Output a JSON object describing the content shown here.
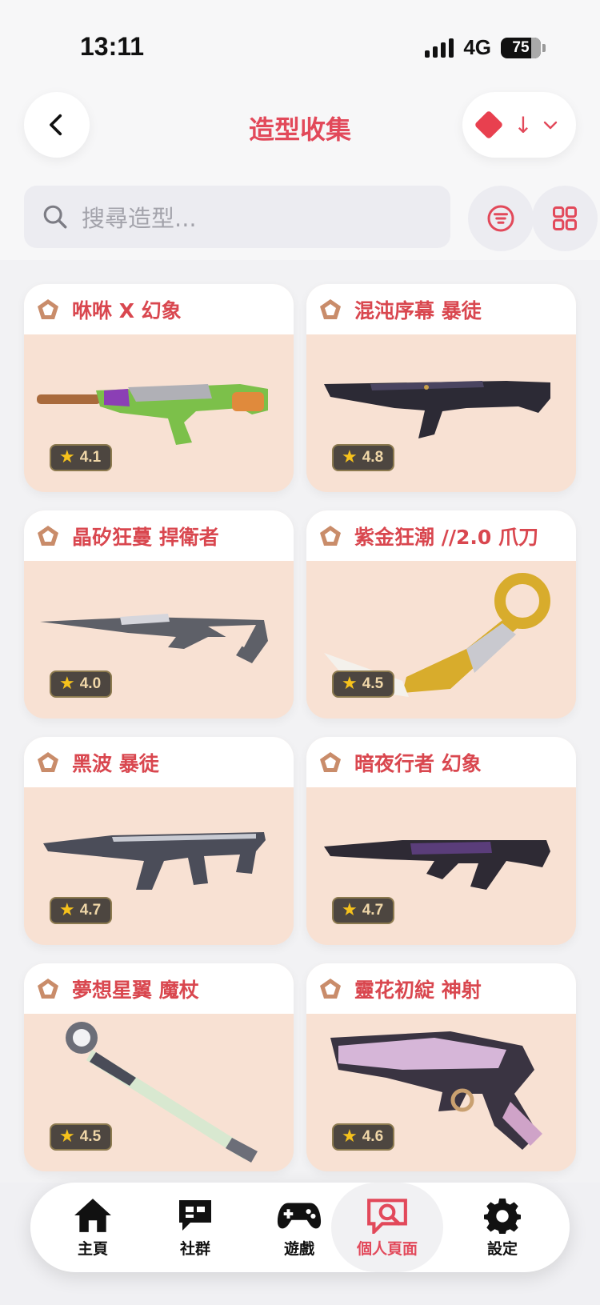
{
  "status": {
    "time": "13:11",
    "network": "4G",
    "battery": "75"
  },
  "header": {
    "title": "造型收集",
    "sort_arrow": "↓",
    "sort_chevron": "⌄"
  },
  "search": {
    "placeholder": "搜尋造型..."
  },
  "colors": {
    "accent": "#e2495a",
    "card_bg": "#f8e1d3",
    "rating_star": "#f6c21c"
  },
  "skins": [
    {
      "name": "咻咻 X 幻象",
      "rating": "4.1"
    },
    {
      "name": "混沌序幕 暴徒",
      "rating": "4.8"
    },
    {
      "name": "晶矽狂蔓 捍衛者",
      "rating": "4.0"
    },
    {
      "name": "紫金狂潮 //2.0 爪刀",
      "rating": "4.5"
    },
    {
      "name": "黑波 暴徒",
      "rating": "4.7"
    },
    {
      "name": "暗夜行者 幻象",
      "rating": "4.7"
    },
    {
      "name": "夢想星翼 魔杖",
      "rating": "4.5"
    },
    {
      "name": "靈花初綻 神射",
      "rating": "4.6"
    }
  ],
  "nav": {
    "items": [
      {
        "label": "主頁",
        "icon": "home-icon"
      },
      {
        "label": "社群",
        "icon": "chat-icon"
      },
      {
        "label": "遊戲",
        "icon": "gamepad-icon"
      },
      {
        "label": "個人頁面",
        "icon": "profile-search-icon"
      },
      {
        "label": "設定",
        "icon": "gear-icon"
      }
    ],
    "active": "個人頁面"
  }
}
